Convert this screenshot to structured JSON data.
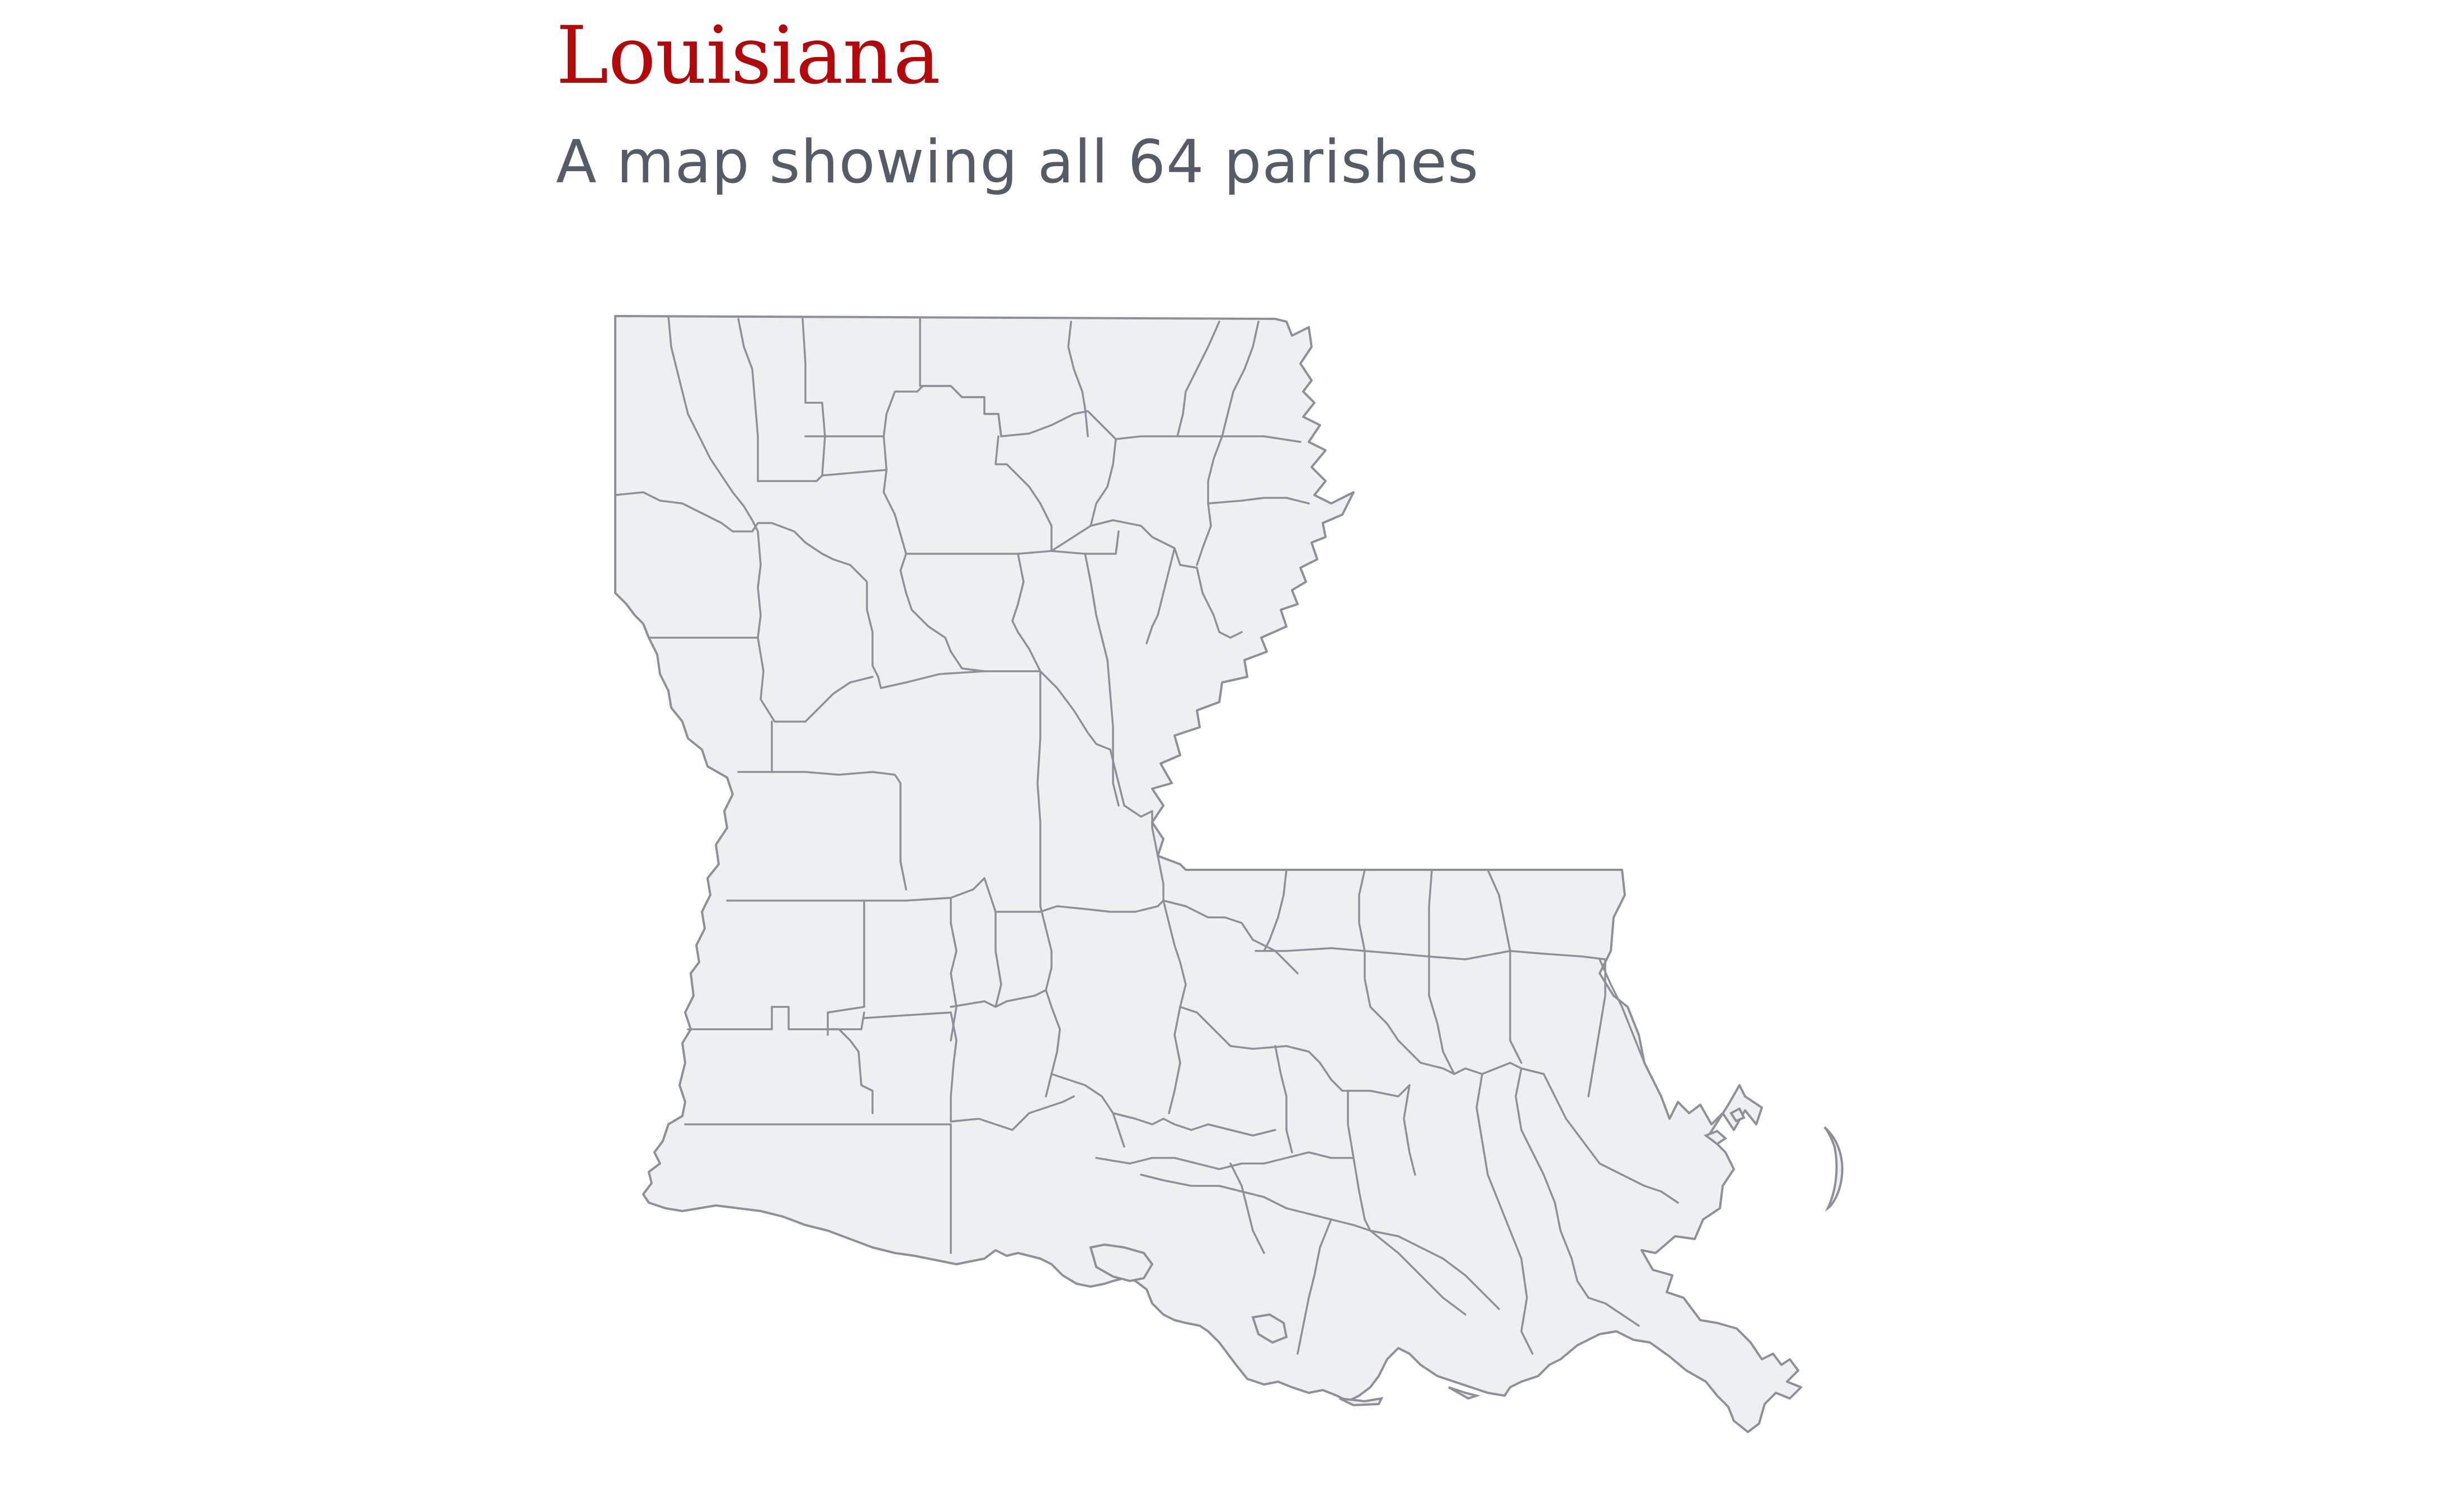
{
  "header": {
    "title": "Louisiana",
    "subtitle": "A map showing all 64 parishes"
  },
  "map": {
    "region": "Louisiana",
    "subdivision_type": "parishes",
    "subdivision_count": 64,
    "fill_color": "#eeeff1",
    "border_color": "#8d9099",
    "title_color": "#b0080b",
    "subtitle_color": "#555b67"
  }
}
